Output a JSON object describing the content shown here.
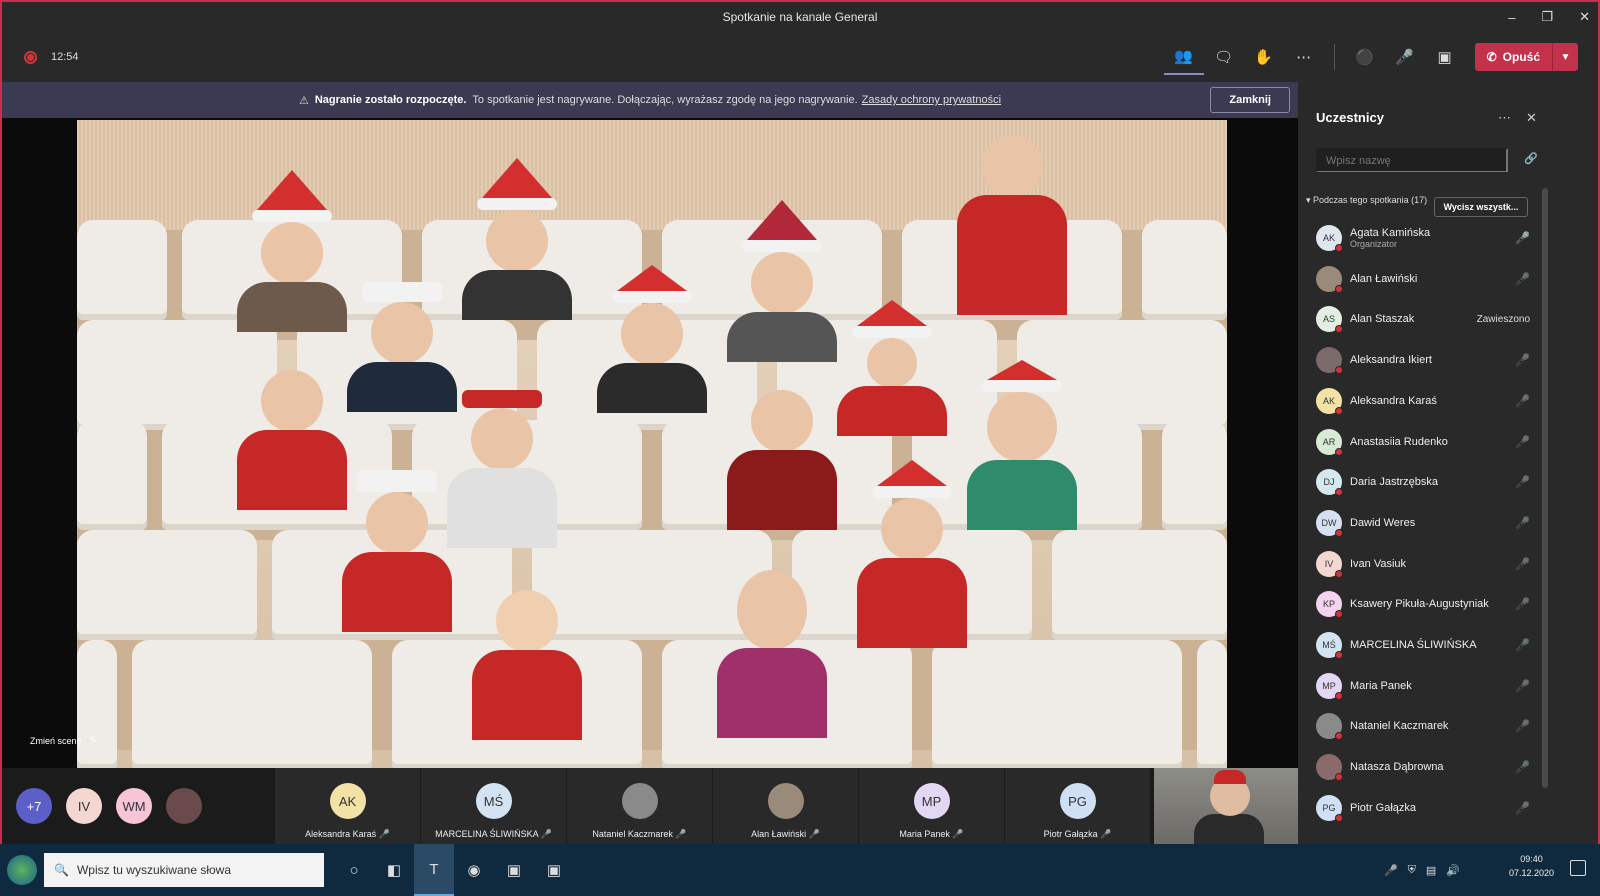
{
  "window": {
    "title": "Spotkanie na kanale General"
  },
  "toolbar": {
    "timer": "12:54",
    "leave_label": "Opuść"
  },
  "banner": {
    "bold": "Nagranie zostało rozpoczęte.",
    "text": "To spotkanie jest nagrywane. Dołączając, wyrażasz zgodę na jego nagrywanie.",
    "link": "Zasady ochrony prywatności",
    "close": "Zamknij"
  },
  "stage": {
    "change_background": "Zmień scenę"
  },
  "strip": {
    "overflow": "+7",
    "mini": [
      {
        "initials": "IV",
        "color": "#f4d7d0"
      },
      {
        "initials": "WM",
        "color": "#f7c4d8"
      }
    ],
    "tiles": [
      {
        "initials": "AK",
        "name": "Aleksandra Karaś",
        "color": "#f3e2a6"
      },
      {
        "initials": "MŚ",
        "name": "MARCELINA ŚLIWIŃSKA",
        "color": "#d4e3f2"
      },
      {
        "initials": "",
        "name": "Nataniel Kaczmarek",
        "color": "#8a8a8a"
      },
      {
        "initials": "",
        "name": "Alan Ławiński",
        "color": "#9a8a7a"
      },
      {
        "initials": "MP",
        "name": "Maria Panek",
        "color": "#e3d7f3"
      },
      {
        "initials": "PG",
        "name": "Piotr Gałązka",
        "color": "#cfe0f5"
      }
    ]
  },
  "panel": {
    "title": "Uczestnicy",
    "search_placeholder": "Wpisz nazwę",
    "section": "Podczas tego spotkania (17)",
    "mute_all": "Wycisz wszystk...",
    "participants": [
      {
        "initials": "AK",
        "name": "Agata Kamińska",
        "role": "Organizator",
        "color": "#dfe6ee",
        "status": "mic"
      },
      {
        "initials": "",
        "name": "Alan Ławiński",
        "role": "",
        "color": "#9a8a7a",
        "status": "muted"
      },
      {
        "initials": "AS",
        "name": "Alan Staszak",
        "role": "",
        "color": "#e3eee3",
        "status": "Zawieszono"
      },
      {
        "initials": "",
        "name": "Aleksandra Ikiert",
        "role": "",
        "color": "#7a6a6a",
        "status": "muted"
      },
      {
        "initials": "AK",
        "name": "Aleksandra Karaś",
        "role": "",
        "color": "#f3e2a6",
        "status": "muted"
      },
      {
        "initials": "AR",
        "name": "Anastasiia Rudenko",
        "role": "",
        "color": "#d6ead6",
        "status": "muted"
      },
      {
        "initials": "DJ",
        "name": "Daria Jastrzębska",
        "role": "",
        "color": "#d5e8ee",
        "status": "muted"
      },
      {
        "initials": "DW",
        "name": "Dawid Weres",
        "role": "",
        "color": "#d6e0f3",
        "status": "muted"
      },
      {
        "initials": "IV",
        "name": "Ivan Vasiuk",
        "role": "",
        "color": "#f4d7d0",
        "status": "muted"
      },
      {
        "initials": "KP",
        "name": "Ksawery Pikuła-Augustyniak",
        "role": "",
        "color": "#f3d3ef",
        "status": "muted"
      },
      {
        "initials": "MŚ",
        "name": "MARCELINA ŚLIWIŃSKA",
        "role": "",
        "color": "#d4e3f2",
        "status": "muted"
      },
      {
        "initials": "MP",
        "name": "Maria Panek",
        "role": "",
        "color": "#e3d7f3",
        "status": "muted"
      },
      {
        "initials": "",
        "name": "Nataniel Kaczmarek",
        "role": "",
        "color": "#8a8a8a",
        "status": "muted"
      },
      {
        "initials": "",
        "name": "Natasza Dąbrowna",
        "role": "",
        "color": "#8a6a6a",
        "status": "muted"
      },
      {
        "initials": "PG",
        "name": "Piotr Gałązka",
        "role": "",
        "color": "#cfe0f5",
        "status": "muted"
      }
    ]
  },
  "taskbar": {
    "search_placeholder": "Wpisz tu wyszukiwane słowa",
    "time": "09:40",
    "date": "07.12.2020"
  }
}
